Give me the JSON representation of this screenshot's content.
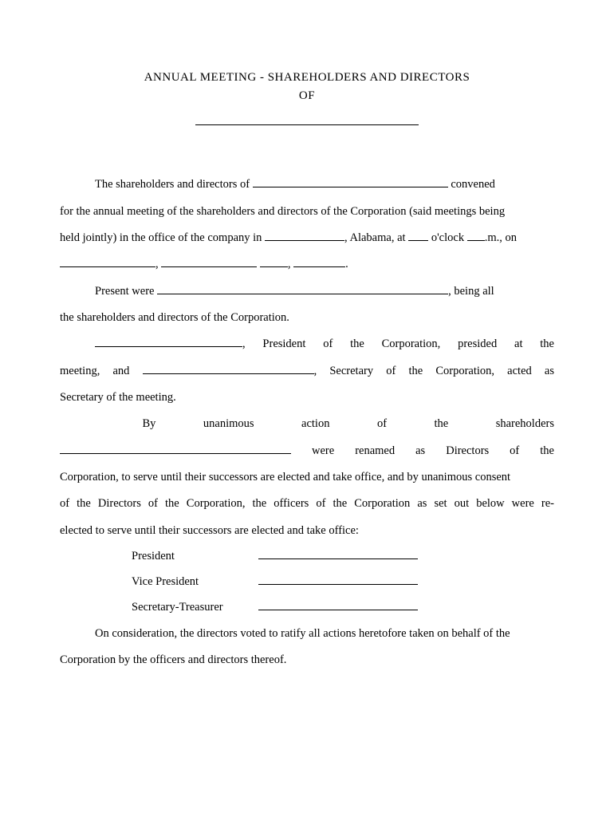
{
  "title": {
    "line1": "ANNUAL MEETING - SHAREHOLDERS AND DIRECTORS",
    "line2": "OF"
  },
  "p1_a": "The shareholders and directors of ",
  "p1_b": " convened",
  "p2": "for the annual meeting of the shareholders and directors of the Corporation (said meetings being",
  "p3_a": "held jointly) in the office of the company in ",
  "p3_b": ", Alabama, at ",
  "p3_c": " o'clock ",
  "p3_d": ".m., on",
  "p4_sep1": ", ",
  "p4_sep2": " ",
  "p4_sep3": ", ",
  "p4_sep4": ".",
  "p5_a": "Present were ",
  "p5_b": ", being all",
  "p6": "the shareholders and directors of the Corporation.",
  "p7_a": ", President of the Corporation, presided at the",
  "p8_a": "meeting, and ",
  "p8_b": ", Secretary of the Corporation, acted as",
  "p9": "Secretary of the meeting.",
  "p10_w1": "By",
  "p10_w2": "unanimous",
  "p10_w3": "action",
  "p10_w4": "of",
  "p10_w5": "the",
  "p10_w6": "shareholders",
  "p11_a": " were renamed as Directors of the",
  "p12": "Corporation, to serve until their successors are elected and take office, and by unanimous consent",
  "p13": "of the Directors of the Corporation, the officers of the Corporation as set out below were re-",
  "p14": "elected to serve until their successors are elected and take office:",
  "officers": {
    "president": "President",
    "vice_president": "Vice President",
    "secretary_treasurer": "Secretary-Treasurer"
  },
  "p15_a": "On consideration, the directors voted to ratify all actions heretofore taken on behalf of the",
  "p16": "Corporation by the officers and directors thereof."
}
